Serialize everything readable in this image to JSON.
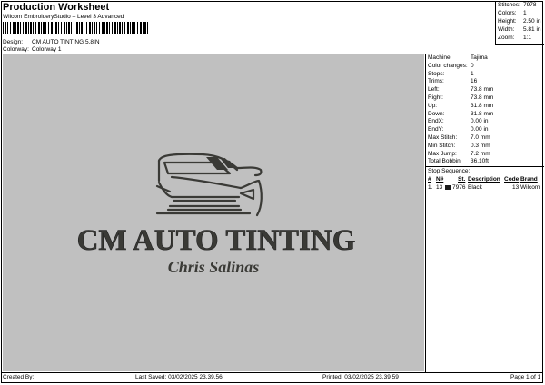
{
  "header": {
    "title": "Production Worksheet",
    "subtitle": "Wilcom EmbroideryStudio – Level 3 Advanced",
    "design_label": "Design:",
    "design_value": "CM AUTO TINTING 5,8IN",
    "colorway_label": "Colorway:",
    "colorway_value": "Colorway 1"
  },
  "stats": [
    {
      "label": "Stitches:",
      "value": "7978"
    },
    {
      "label": "Colors:",
      "value": "1"
    },
    {
      "label": "Height:",
      "value": "2.50 in"
    },
    {
      "label": "Width:",
      "value": "5.81 in"
    },
    {
      "label": "Zoom:",
      "value": "1:1"
    }
  ],
  "properties": [
    {
      "label": "Machine:",
      "value": "Tajima"
    },
    {
      "label": "Color changes:",
      "value": "0"
    },
    {
      "label": "Stops:",
      "value": "1"
    },
    {
      "label": "Trims:",
      "value": "16"
    },
    {
      "label": "Left:",
      "value": "73.8 mm"
    },
    {
      "label": "Right:",
      "value": "73.8 mm"
    },
    {
      "label": "Up:",
      "value": "31.8 mm"
    },
    {
      "label": "Down:",
      "value": "31.8 mm"
    },
    {
      "label": "EndX:",
      "value": "0.00 in"
    },
    {
      "label": "EndY:",
      "value": "0.00 in"
    },
    {
      "label": "Max Stitch:",
      "value": "7.0 mm"
    },
    {
      "label": "Min Stitch:",
      "value": "0.3 mm"
    },
    {
      "label": "Max Jump:",
      "value": "7.2 mm"
    },
    {
      "label": "Total Bobbin:",
      "value": "36.10ft"
    }
  ],
  "stop_sequence": {
    "title": "Stop Sequence:",
    "columns": [
      "#",
      "N#",
      "St.",
      "Description",
      "Code",
      "Brand"
    ],
    "rows": [
      {
        "num": "1.",
        "n": "13",
        "swatch": "#1a1a1a",
        "st": "7976",
        "description": "Black",
        "code": "13",
        "brand": "Wilcom"
      }
    ]
  },
  "design": {
    "main_text": "CM AUTO TINTING",
    "script_text": "Chris Salinas",
    "thread_color": "#3a3a36",
    "background": "#c0c0c0"
  },
  "footer": {
    "created": "Created By:",
    "last_saved": "Last Saved: 03/02/2025 23.39.56",
    "printed": "Printed: 03/02/2025 23.39.59",
    "page": "Page 1 of 1"
  }
}
